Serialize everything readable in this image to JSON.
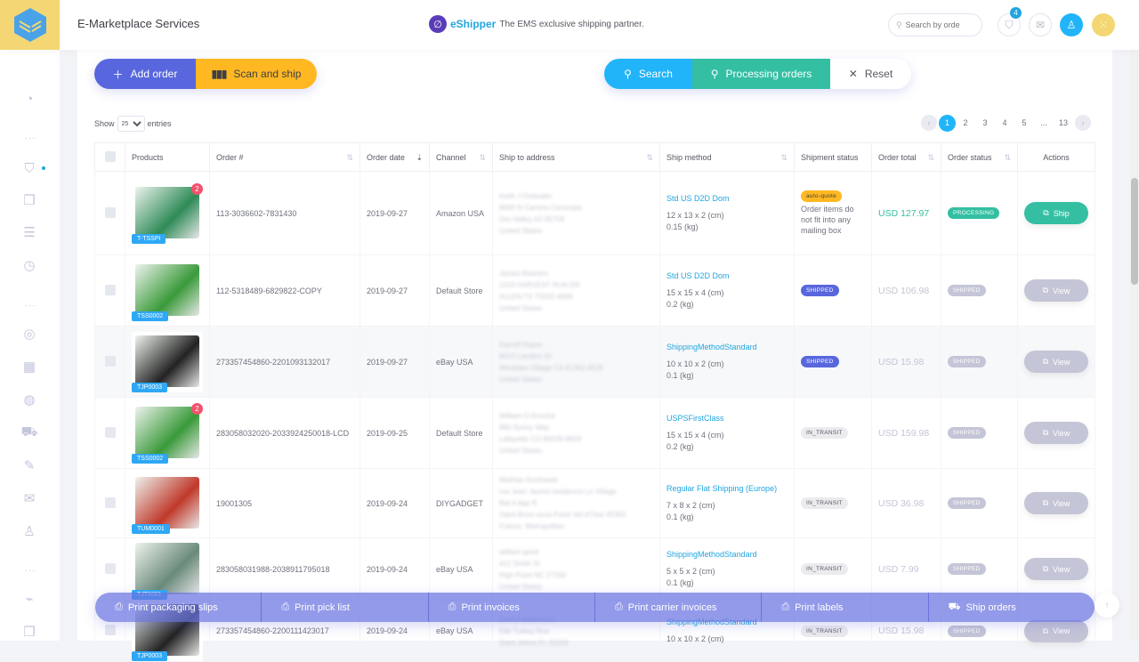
{
  "header": {
    "app_title": "E-Marketplace Services",
    "partner_brand": "eShipper",
    "partner_tagline": "The EMS exclusive shipping partner.",
    "search_placeholder": "Search by orde",
    "cart_badge": "4",
    "icons": [
      "logo-cube-icon",
      "search-icon",
      "shopping-bag-icon",
      "mail-icon",
      "user-icon",
      "apps-grid-icon"
    ]
  },
  "sidebar": {
    "items": [
      {
        "icon": "dashboard-gauge-icon",
        "glyph": "◔"
      },
      {
        "icon": "shopping-bag-icon",
        "glyph": "👜",
        "active": true
      },
      {
        "icon": "box-open-icon",
        "glyph": "❒"
      },
      {
        "icon": "message-icon",
        "glyph": "☰"
      },
      {
        "icon": "timer-icon",
        "glyph": "◷"
      },
      {
        "icon": "user-circle-icon",
        "glyph": "◎"
      },
      {
        "icon": "grid-icon",
        "glyph": "▦"
      },
      {
        "icon": "globe-icon",
        "glyph": "◍"
      },
      {
        "icon": "truck-icon",
        "glyph": "⛟"
      },
      {
        "icon": "edit-document-icon",
        "glyph": "✎"
      },
      {
        "icon": "envelope-icon",
        "glyph": "✉"
      },
      {
        "icon": "users-icon",
        "glyph": "♙"
      },
      {
        "icon": "presentation-chart-icon",
        "glyph": "⌁"
      },
      {
        "icon": "box-icon",
        "glyph": "❒"
      }
    ],
    "separator": "···"
  },
  "toolbar": {
    "add_order": "Add order",
    "scan_and_ship": "Scan and ship",
    "search": "Search",
    "processing_orders": "Processing orders",
    "reset": "Reset"
  },
  "table_controls": {
    "show_label": "Show",
    "entries_value": "25",
    "entries_label": "entries",
    "pages": [
      "1",
      "2",
      "3",
      "4",
      "5",
      "...",
      "13"
    ],
    "current_page": "1",
    "prev": "‹",
    "next": "›"
  },
  "columns": [
    "Products",
    "Order #",
    "Order date",
    "Channel",
    "Ship to address",
    "Ship method",
    "Shipment status",
    "Order total",
    "Order status",
    "Actions"
  ],
  "rows": [
    {
      "sku": "T-TSSPI",
      "qty": "2",
      "order": "113-3036602-7831430",
      "date": "2019-09-27",
      "channel": "Amazon USA",
      "address": [
        "Keith J Outwater",
        "8600 N Camino Coronado",
        "Oro Valley AZ 85704",
        "United States"
      ],
      "method": "Std US D2D Dom",
      "dims": "12 x 13 x 2 (cm)",
      "weight": "0.15 (kg)",
      "shipment_status": "auto-quote",
      "shipment_note": "Order items do not fit into any mailing box",
      "total": "USD 127.97",
      "order_status": "PROCESSING",
      "action": "Ship"
    },
    {
      "sku": "TSS0002",
      "qty": "",
      "order": "112-5318489-6829822-COPY",
      "date": "2019-09-27",
      "channel": "Default Store",
      "address": [
        "James Beavers",
        "1523 HARVEST RUN DR",
        "ALLEN TX 75002-4589",
        "United States"
      ],
      "method": "Std US D2D Dom",
      "dims": "15 x 15 x 4 (cm)",
      "weight": "0.2 (kg)",
      "shipment_status": "SHIPPED",
      "shipment_note": "",
      "total": "USD 106.98",
      "order_status": "SHIPPED",
      "action": "View"
    },
    {
      "sku": "TJP0003",
      "qty": "",
      "order": "273357454860-2201093132017",
      "date": "2019-09-27",
      "channel": "eBay USA",
      "address": [
        "Darrell Hayes",
        "8553 Landino Dr",
        "Westlake Village CA 91362-4526",
        "United States"
      ],
      "method": "ShippingMethodStandard",
      "dims": "10 x 10 x 2 (cm)",
      "weight": "0.1 (kg)",
      "shipment_status": "SHIPPED",
      "shipment_note": "",
      "total": "USD 15.98",
      "order_status": "SHIPPED",
      "action": "View"
    },
    {
      "sku": "TSS0002",
      "qty": "2",
      "order": "283058032020-2033924250018-LCD",
      "date": "2019-09-25",
      "channel": "Default Store",
      "address": [
        "William D Knoche",
        "880 Sunny Way",
        "Lafayette CO 80026-8829",
        "United States"
      ],
      "method": "USPSFirstClass",
      "dims": "15 x 15 x 4 (cm)",
      "weight": "0.2 (kg)",
      "shipment_status": "IN_TRANSIT",
      "shipment_note": "",
      "total": "USD 159.98",
      "order_status": "SHIPPED",
      "action": "View"
    },
    {
      "sku": "TUM0001",
      "qty": "",
      "order": "19001305",
      "date": "2019-09-24",
      "channel": "DIYGADGET",
      "address": [
        "Mathias Kozlowski",
        "rue Jean Jaures residence Le Village",
        "Bat A App R",
        "Saint-Brice-sous-Foret Val d'Oise 95350",
        "France, Metropolitan"
      ],
      "method": "Regular Flat Shipping (Europe)",
      "dims": "7 x 8 x 2 (cm)",
      "weight": "0.1 (kg)",
      "shipment_status": "IN_TRANSIT",
      "shipment_note": "",
      "total": "USD 36.98",
      "order_status": "SHIPPED",
      "action": "View"
    },
    {
      "sku": "TJT0001",
      "qty": "",
      "order": "283058031988-2038911795018",
      "date": "2019-09-24",
      "channel": "eBay USA",
      "address": [
        "william quick",
        "412 Smith St",
        "High Point NC 27260",
        "United States"
      ],
      "method": "ShippingMethodStandard",
      "dims": "5 x 5 x 2 (cm)",
      "weight": "0.1 (kg)",
      "shipment_status": "IN_TRANSIT",
      "shipment_note": "",
      "total": "USD 7.99",
      "order_status": "SHIPPED",
      "action": "View"
    },
    {
      "sku": "TJP0003",
      "qty": "",
      "order": "273357454860-2200111423017",
      "date": "2019-09-24",
      "channel": "eBay USA",
      "address": [
        "Cheryl Williamson",
        "546 Turkey Run",
        "Saint Johns FL 32259"
      ],
      "method": "ShippingMethodStandard",
      "dims": "10 x 10 x 2 (cm)",
      "weight": "",
      "shipment_status": "IN_TRANSIT",
      "shipment_note": "",
      "total": "USD 15.98",
      "order_status": "SHIPPED",
      "action": "View"
    }
  ],
  "bulk_actions": [
    {
      "label": "Print packaging slips",
      "icon": "printer-icon"
    },
    {
      "label": "Print pick list",
      "icon": "printer-icon"
    },
    {
      "label": "Print invoices",
      "icon": "printer-icon"
    },
    {
      "label": "Print carrier invoices",
      "icon": "printer-icon"
    },
    {
      "label": "Print labels",
      "icon": "printer-icon"
    },
    {
      "label": "Ship orders",
      "icon": "truck-icon"
    }
  ],
  "colors": {
    "primary": "#5867dd",
    "warning": "#ffb822",
    "info": "#21b4f8",
    "success": "#34bfa3",
    "logo_bg": "#f4d774",
    "danger": "#f4516c"
  }
}
